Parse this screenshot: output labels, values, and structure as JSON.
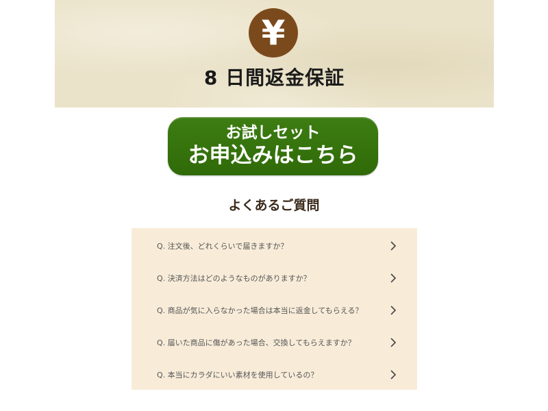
{
  "banner": {
    "icon_glyph": "¥",
    "icon_name": "yen-icon",
    "title": "8 日間返金保証",
    "colors": {
      "background": "#ebe3c9",
      "icon_circle": "#7b4a1c"
    }
  },
  "cta": {
    "line1": "お試しセット",
    "line2": "お申込みはこちら",
    "color": "#3d7d12"
  },
  "faq": {
    "heading": "よくあるご質問",
    "background": "#f8ecd9",
    "items": [
      {
        "question": "Q. 注文後、どれくらいで届きますか？",
        "icon": "chevron-right-icon"
      },
      {
        "question": "Q. 決済方法はどのようなものがありますか？",
        "icon": "chevron-right-icon"
      },
      {
        "question": "Q. 商品が気に入らなかった場合は本当に返金してもらえる？",
        "icon": "chevron-right-icon"
      },
      {
        "question": "Q. 届いた商品に傷があった場合、交換してもらえますか？",
        "icon": "chevron-right-icon"
      },
      {
        "question": "Q. 本当にカラダにいい素材を使用しているの？",
        "icon": "chevron-right-icon"
      }
    ]
  }
}
